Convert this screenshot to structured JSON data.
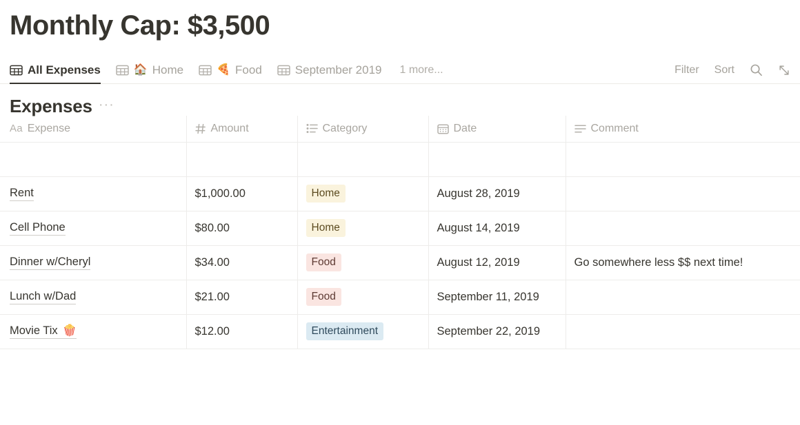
{
  "header": {
    "title": "Monthly Cap: $3,500"
  },
  "viewbar": {
    "tabs": [
      {
        "label": "All Expenses",
        "emoji": "",
        "icon": "table-grid-icon",
        "active": true
      },
      {
        "label": "Home",
        "emoji": "🏠",
        "icon": "table-grid-icon",
        "active": false
      },
      {
        "label": "Food",
        "emoji": "🍕",
        "icon": "table-grid-icon",
        "active": false
      },
      {
        "label": "September 2019",
        "emoji": "",
        "icon": "table-grid-icon",
        "active": false
      }
    ],
    "more_label": "1 more...",
    "actions": [
      {
        "label": "Filter",
        "icon": ""
      },
      {
        "label": "Sort",
        "icon": ""
      },
      {
        "label": "",
        "icon": "search-icon"
      },
      {
        "label": "",
        "icon": "expand-icon"
      }
    ]
  },
  "block": {
    "title": "Expenses",
    "menu_label": "···"
  },
  "table": {
    "columns": [
      {
        "label": "Expense",
        "icon": "text-aa-icon"
      },
      {
        "label": "Amount",
        "icon": "number-hash-icon"
      },
      {
        "label": "Category",
        "icon": "multi-select-icon"
      },
      {
        "label": "Date",
        "icon": "calendar-icon"
      },
      {
        "label": "Comment",
        "icon": "text-lines-icon"
      }
    ],
    "rows": [
      {
        "expense": "",
        "emoji": "",
        "amount": "",
        "category": "",
        "category_color": "",
        "date": "",
        "comment": ""
      },
      {
        "expense": "Rent",
        "emoji": "",
        "amount": "$1,000.00",
        "category": "Home",
        "category_color": "#faf3dd",
        "date": "August 28, 2019",
        "comment": ""
      },
      {
        "expense": "Cell Phone",
        "emoji": "",
        "amount": "$80.00",
        "category": "Home",
        "category_color": "#faf3dd",
        "date": "August 14, 2019",
        "comment": ""
      },
      {
        "expense": "Dinner w/Cheryl",
        "emoji": "",
        "amount": "$34.00",
        "category": "Food",
        "category_color": "#fae5e1",
        "date": "August 12, 2019",
        "comment": "Go somewhere less $$ next time!"
      },
      {
        "expense": "Lunch w/Dad",
        "emoji": "",
        "amount": "$21.00",
        "category": "Food",
        "category_color": "#fae5e1",
        "date": "September 11, 2019",
        "comment": ""
      },
      {
        "expense": "Movie Tix",
        "emoji": "🍿",
        "amount": "$12.00",
        "category": "Entertainment",
        "category_color": "#dbeaf2",
        "date": "September 22, 2019",
        "comment": ""
      }
    ]
  }
}
